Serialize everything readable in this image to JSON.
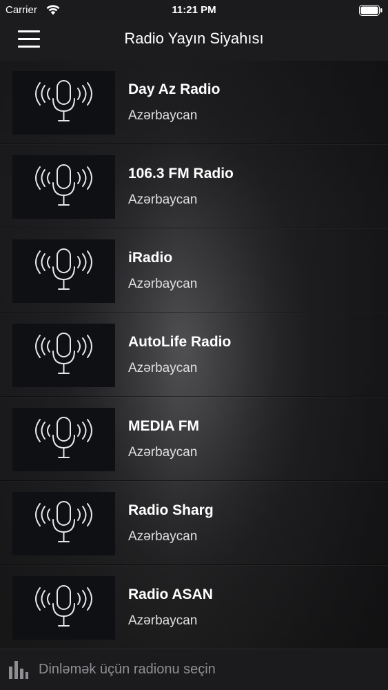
{
  "status_bar": {
    "carrier": "Carrier",
    "time": "11:21 PM"
  },
  "nav": {
    "title": "Radio Yayın Siyahısı"
  },
  "stations": [
    {
      "name": "Day Az Radio",
      "country": "Azərbaycan",
      "icon": "microphone-broadcast-icon"
    },
    {
      "name": "106.3 FM Radio",
      "country": "Azərbaycan",
      "icon": "microphone-broadcast-icon"
    },
    {
      "name": "iRadio",
      "country": "Azərbaycan",
      "icon": "microphone-broadcast-icon"
    },
    {
      "name": "AutoLife Radio",
      "country": "Azərbaycan",
      "icon": "microphone-broadcast-icon"
    },
    {
      "name": "MEDIA FM",
      "country": "Azərbaycan",
      "icon": "microphone-broadcast-icon"
    },
    {
      "name": "Radio Sharg",
      "country": "Azərbaycan",
      "icon": "microphone-broadcast-icon"
    },
    {
      "name": "Radio ASAN",
      "country": "Azərbaycan",
      "icon": "microphone-broadcast-icon"
    }
  ],
  "player": {
    "prompt": "Dinləmək üçün radionu seçin",
    "icon": "equalizer-icon"
  },
  "colors": {
    "background": "#1c1c1e",
    "thumb_background": "#0e1013",
    "subtitle_text": "#e0e0e0",
    "player_text": "#8e8e93"
  }
}
